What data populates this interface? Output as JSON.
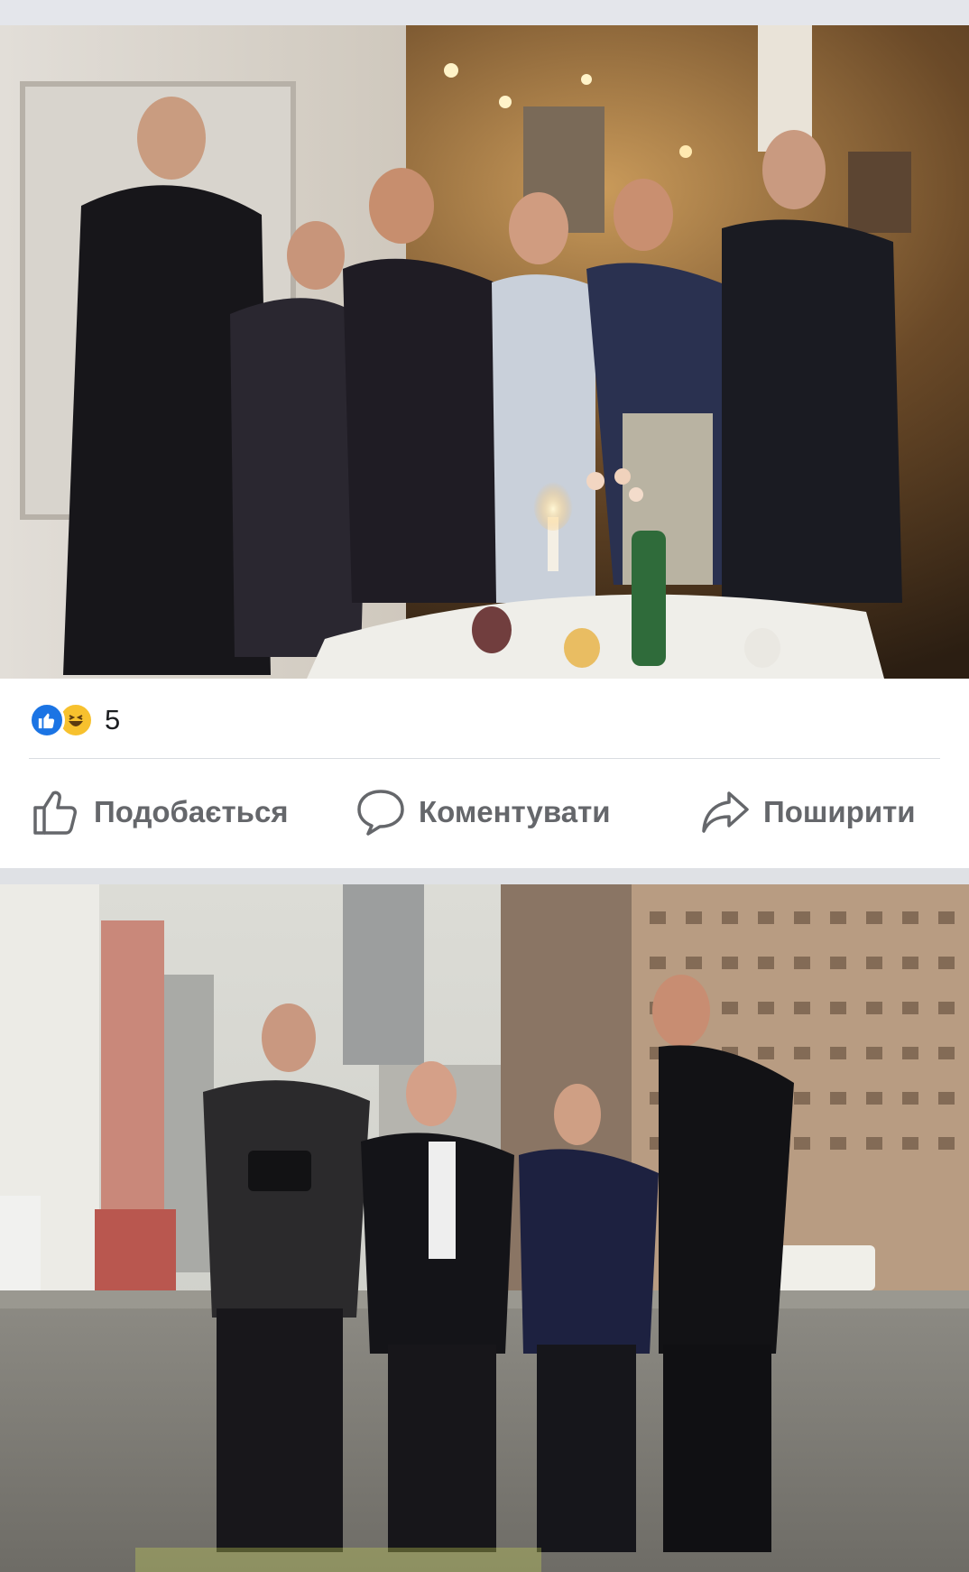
{
  "post": {
    "reactions": {
      "types": [
        "like-icon",
        "haha-icon"
      ],
      "count": "5",
      "colors": {
        "like": "#1b74e4",
        "haha": "#f7c12e"
      }
    },
    "actions": {
      "like_label": "Подобається",
      "comment_label": "Коментувати",
      "share_label": "Поширити"
    }
  },
  "colors": {
    "separator": "#e4e6eb",
    "action_text": "#65676b"
  }
}
